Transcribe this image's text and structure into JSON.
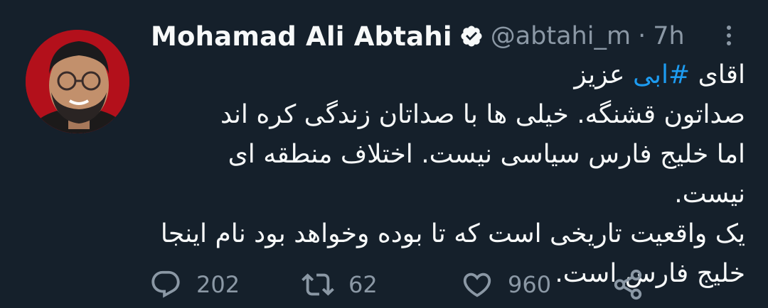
{
  "tweet": {
    "author_name": "Mohamad Ali Abtahi",
    "handle": "@abtahi_m",
    "separator": "·",
    "time": "7h",
    "line1_prefix": "اقای ",
    "line1_hashtag": "#ابی",
    "line1_suffix": " عزیز",
    "lines": [
      "صداتون قشنگه. خیلی ها با صداتان زندگی کره اند",
      "اما خلیج فارس سیاسی نیست. اختلاف منطقه ای نیست.",
      "یک واقعیت تاریخی است که تا بوده وخواهد بود نام اینجا",
      "خلیج فارس است."
    ]
  },
  "actions": {
    "replies": "202",
    "retweets": "62",
    "likes": "960"
  },
  "icons": {
    "verified": "verified-badge-icon",
    "more": "more-vertical-icon",
    "reply": "reply-bubble-icon",
    "retweet": "retweet-icon",
    "like": "heart-icon",
    "share": "share-icon"
  },
  "colors": {
    "background": "#15202b",
    "text": "#f7f9f9",
    "muted": "#8b98a5",
    "link": "#1d9bf0"
  }
}
